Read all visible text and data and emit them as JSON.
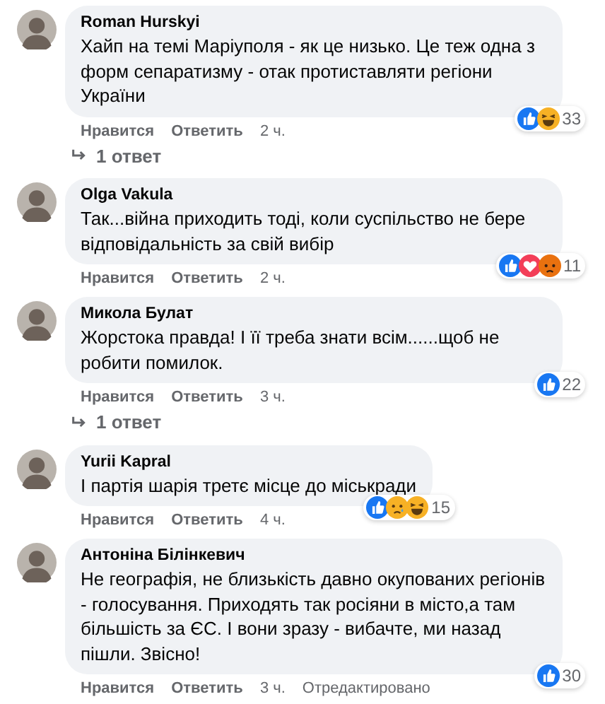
{
  "comments": [
    {
      "author": "Roman Hurskyi",
      "text": "Хайп на темі Маріуполя - як це низько. Це теж одна з форм сепаратизму - отак протиставляти регіони України",
      "reactions": [
        {
          "kind": "like"
        },
        {
          "kind": "haha"
        }
      ],
      "reaction_count": "33",
      "actions": [
        "Нравится",
        "Ответить",
        "2 ч."
      ],
      "replies": "1 ответ"
    },
    {
      "author": "Olga Vakula",
      "text": "Так...війна приходить тоді, коли суспільство не бере відповідальність за свій вибір",
      "reactions": [
        {
          "kind": "like"
        },
        {
          "kind": "love"
        },
        {
          "kind": "angry"
        }
      ],
      "reaction_count": "11",
      "actions": [
        "Нравится",
        "Ответить",
        "2 ч."
      ]
    },
    {
      "author": "Микола Булат",
      "text": "Жорстока правда! І її треба знати всім......щоб не робити помилок.",
      "reactions": [
        {
          "kind": "like"
        }
      ],
      "reaction_count": "22",
      "actions": [
        "Нравится",
        "Ответить",
        "3 ч."
      ],
      "replies": "1 ответ"
    },
    {
      "author": "Yurii Kapral",
      "text": "І партія шарія третє місце до міськради",
      "reactions": [
        {
          "kind": "like"
        },
        {
          "kind": "sad"
        },
        {
          "kind": "haha"
        }
      ],
      "reaction_count": "15",
      "actions": [
        "Нравится",
        "Ответить",
        "4 ч."
      ]
    },
    {
      "author": "Антоніна Білінкевич",
      "text": "Не географія, не близькість давно окупованих регіонів - голосування. Приходять так росіяни в місто,а там більшість за ЄС. І вони зразу - вибачте, ми назад пішли. Звісно!",
      "reactions": [
        {
          "kind": "like"
        }
      ],
      "reaction_count": "30",
      "actions": [
        "Нравится",
        "Ответить",
        "3 ч.",
        "Отредактировано"
      ]
    }
  ]
}
